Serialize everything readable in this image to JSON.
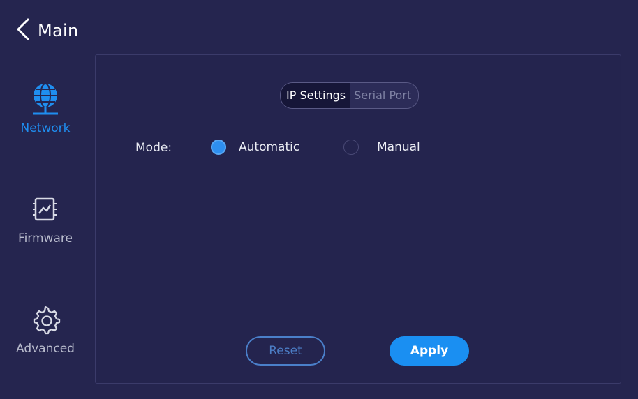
{
  "header": {
    "back_label": "Main",
    "back_icon": "chevron-left-icon"
  },
  "sidebar": {
    "items": [
      {
        "label": "Network",
        "icon": "globe-network-icon",
        "active": true
      },
      {
        "label": "Firmware",
        "icon": "firmware-chip-icon",
        "active": false
      },
      {
        "label": "Advanced",
        "icon": "gear-icon",
        "active": false
      }
    ]
  },
  "tabs": [
    {
      "label": "IP Settings",
      "active": true
    },
    {
      "label": "Serial Port",
      "active": false
    }
  ],
  "mode": {
    "label": "Mode:",
    "options": [
      {
        "label": "Automatic",
        "selected": true
      },
      {
        "label": "Manual",
        "selected": false
      }
    ]
  },
  "buttons": {
    "reset": "Reset",
    "apply": "Apply"
  },
  "colors": {
    "background": "#25254f",
    "accent": "#1a8ff2",
    "active_label": "#1f8ef0"
  }
}
